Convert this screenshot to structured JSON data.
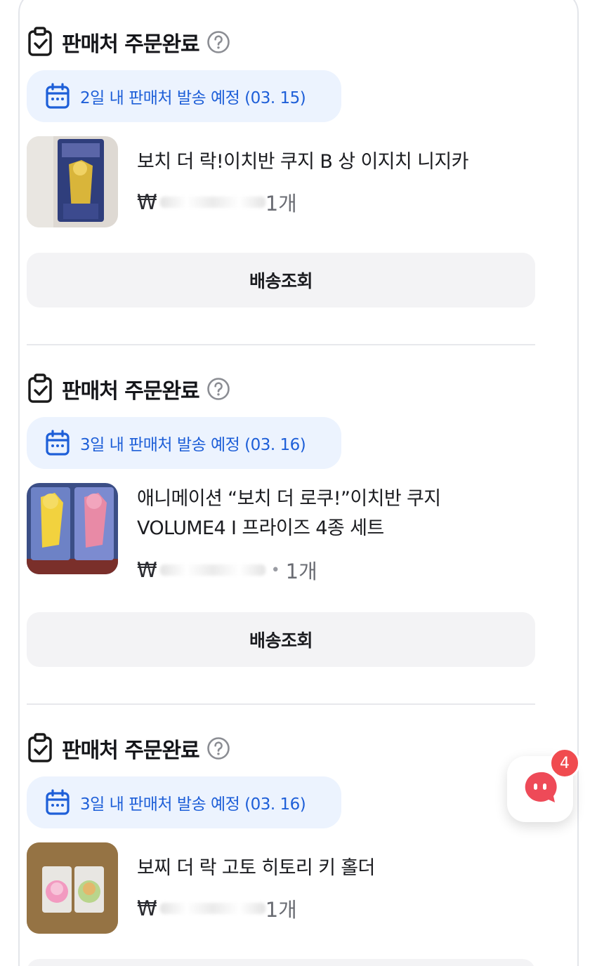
{
  "orders": [
    {
      "status_title": "판매처 주문완료",
      "ship_text": "2일 내 판매처 발송 예정 (03. 15)",
      "product_name": "보치 더 락!이치반 쿠지 B 상 이지치 니지카",
      "price_visible": "₩",
      "quantity": "1개",
      "track_button": "배송조회"
    },
    {
      "status_title": "판매처 주문완료",
      "ship_text": "3일 내 판매처 발송 예정 (03. 16)",
      "product_name": "애니메이션 “보치 더 로쿠!”이치반 쿠지 VOLUME4 I 프라이즈 4종 세트",
      "price_visible": "₩",
      "quantity": "1개",
      "track_button": "배송조회"
    },
    {
      "status_title": "판매처 주문완료",
      "ship_text": "3일 내 판매처 발송 예정 (03. 16)",
      "product_name": "보찌 더 락 고토 히토리 키 홀더",
      "price_visible": "₩",
      "quantity": "1개",
      "track_button": ""
    }
  ],
  "chat": {
    "badge_count": "4"
  },
  "colors": {
    "accent_blue": "#1e5fd8",
    "pill_bg": "#ecf3fe",
    "badge_red": "#f04b4f",
    "chat_red": "#ee4a58"
  }
}
